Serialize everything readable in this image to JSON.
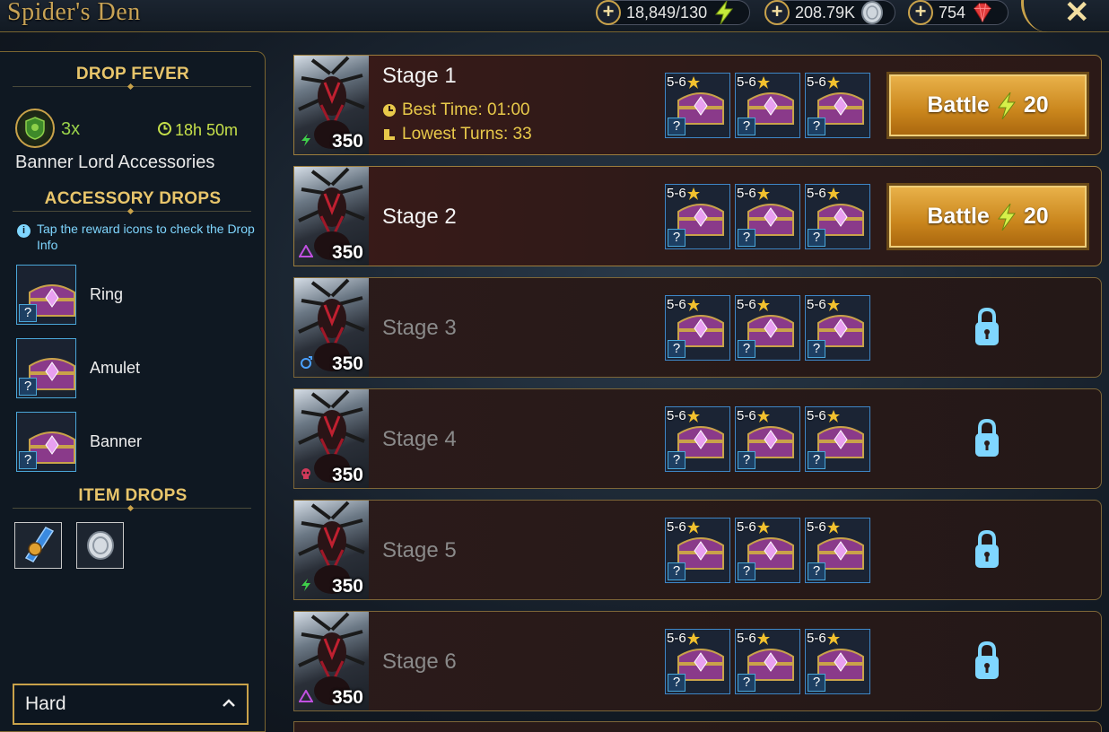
{
  "header": {
    "title": "Spider's Den",
    "resources": [
      {
        "value": "18,849/130",
        "icon": "energy-icon"
      },
      {
        "value": "208.79K",
        "icon": "silver-icon"
      },
      {
        "value": "754",
        "icon": "gem-icon"
      }
    ]
  },
  "sidebar": {
    "drop_fever_title": "DROP FEVER",
    "fever_multiplier": "3x",
    "fever_time": "18h 50m",
    "fever_name": "Banner Lord Accessories",
    "accessory_drops_title": "ACCESSORY DROPS",
    "info_text": "Tap the reward icons to check the Drop Info",
    "accessories": [
      {
        "label": "Ring"
      },
      {
        "label": "Amulet"
      },
      {
        "label": "Banner"
      }
    ],
    "item_drops_title": "ITEM DROPS",
    "difficulty": "Hard"
  },
  "stages": [
    {
      "name": "Stage 1",
      "level": "350",
      "affinity": "force",
      "best_time": "Best Time: 01:00",
      "lowest_turns": "Lowest Turns: 33",
      "locked": false,
      "battle_label": "Battle",
      "cost": "20"
    },
    {
      "name": "Stage 2",
      "level": "350",
      "affinity": "magic",
      "locked": false,
      "battle_label": "Battle",
      "cost": "20"
    },
    {
      "name": "Stage 3",
      "level": "350",
      "affinity": "spirit",
      "locked": true
    },
    {
      "name": "Stage 4",
      "level": "350",
      "affinity": "void",
      "locked": true
    },
    {
      "name": "Stage 5",
      "level": "350",
      "affinity": "force",
      "locked": true
    },
    {
      "name": "Stage 6",
      "level": "350",
      "affinity": "magic",
      "locked": true
    }
  ],
  "reward_range": "5-6",
  "reward_badge": "?",
  "colors": {
    "gold": "#c9a24a",
    "accent_blue": "#7fd6ff",
    "fever_green": "#9ad24a"
  }
}
